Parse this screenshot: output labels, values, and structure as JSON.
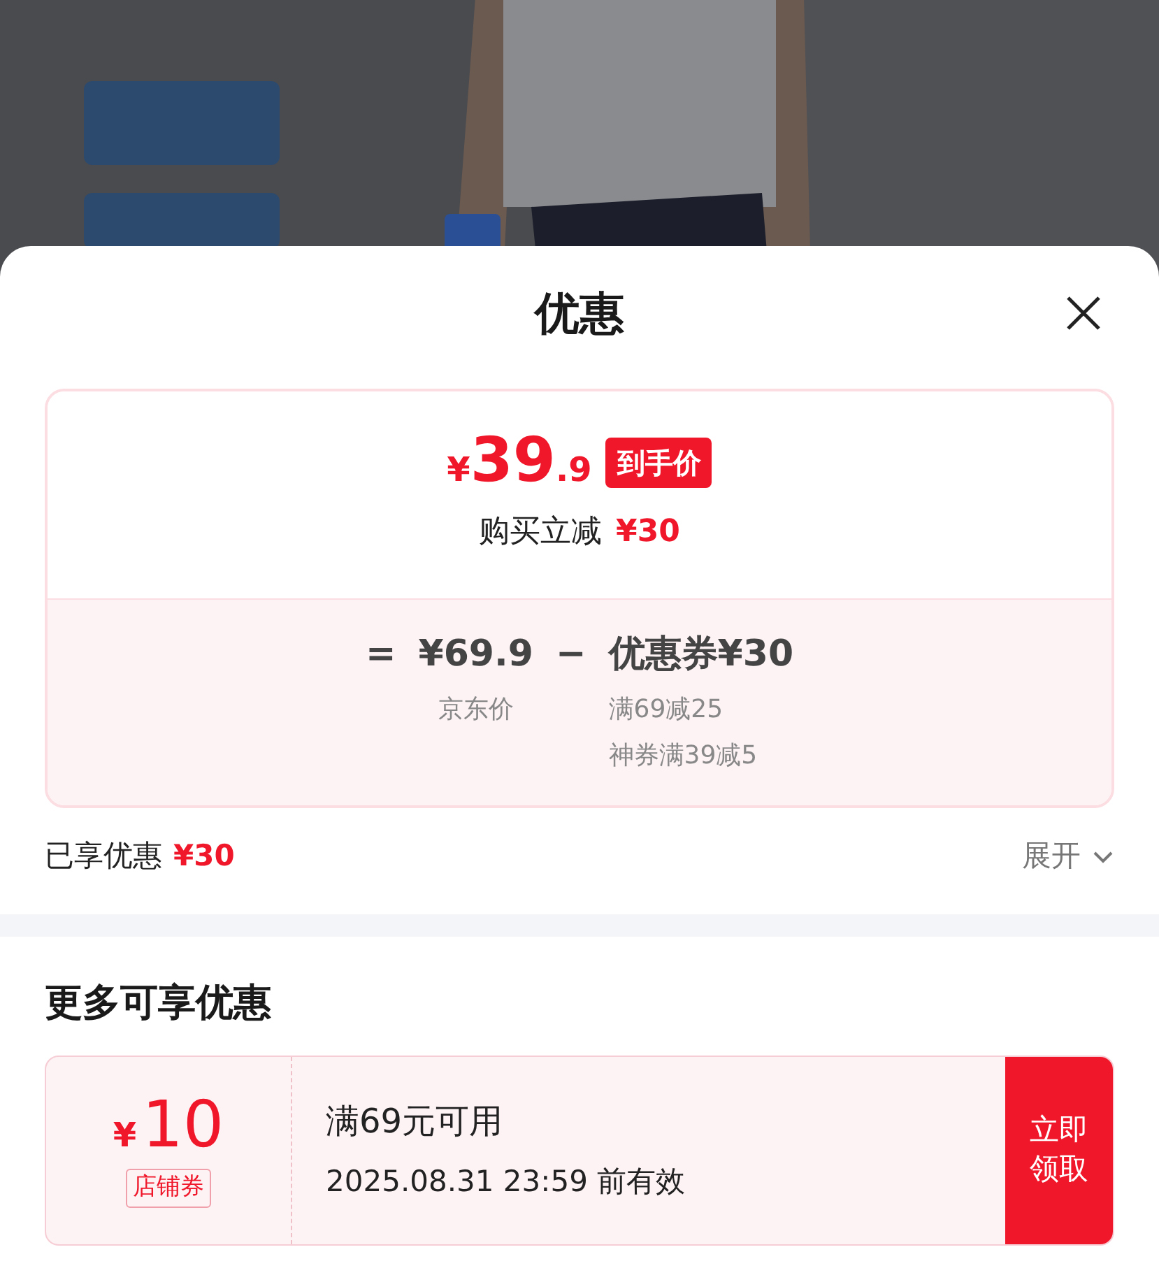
{
  "sheet": {
    "title": "优惠"
  },
  "price_card": {
    "currency": "¥",
    "integer": "39",
    "decimal": ".9",
    "badge": "到手价",
    "saving_label": "购买立减",
    "saving_amount": "¥30",
    "equals": "=",
    "base_price": "¥69.9",
    "base_label": "京东价",
    "minus": "−",
    "coupon_total": "优惠券¥30",
    "coupon_lines": [
      "满69减25",
      "神券满39减5"
    ]
  },
  "enjoyed": {
    "label": "已享优惠",
    "amount": "¥30",
    "expand": "展开",
    "expanded": false
  },
  "more": {
    "title": "更多可享优惠",
    "coupons": [
      {
        "currency": "¥",
        "amount": "10",
        "tag": "店铺券",
        "condition": "满69元可用",
        "validity": "2025.08.31 23:59 前有效",
        "action": "立即领取"
      }
    ]
  }
}
